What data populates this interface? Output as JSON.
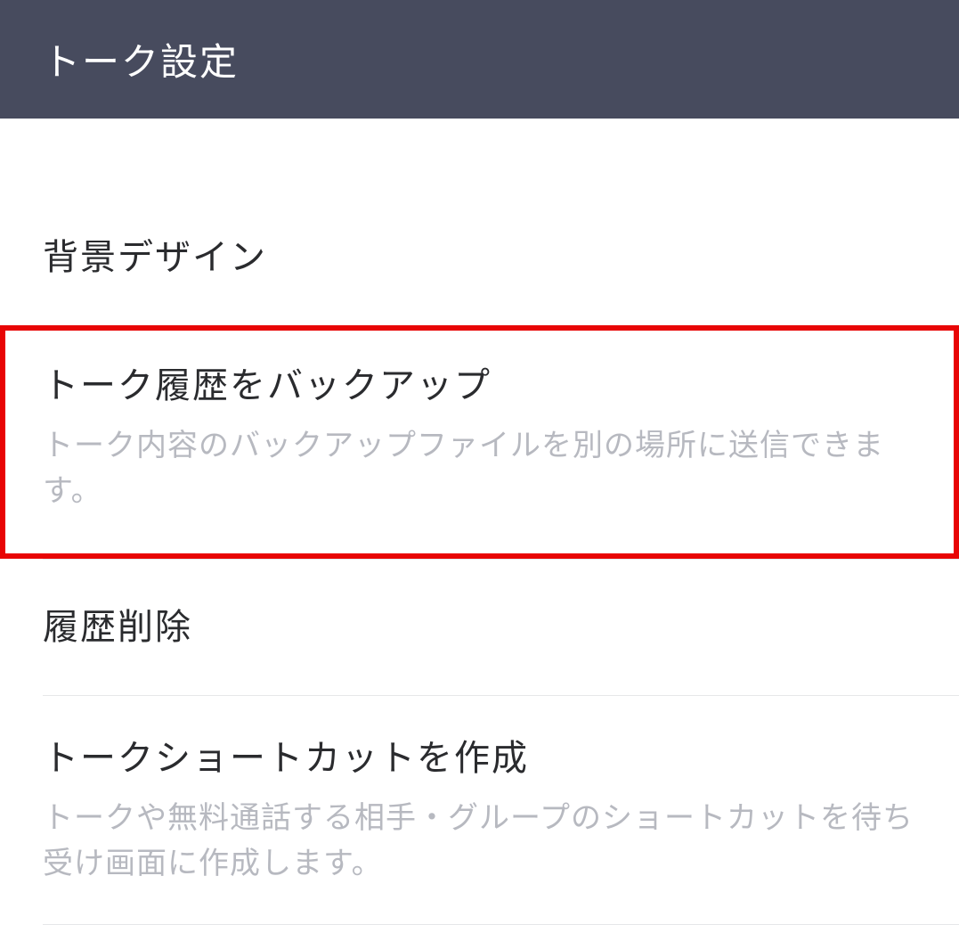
{
  "header": {
    "title": "トーク設定"
  },
  "items": [
    {
      "title": "背景デザイン",
      "description": null
    },
    {
      "title": "トーク履歴をバックアップ",
      "description": "トーク内容のバックアップファイルを別の場所に送信できます。",
      "highlighted": true
    },
    {
      "title": "履歴削除",
      "description": null
    },
    {
      "title": "トークショートカットを作成",
      "description": "トークや無料通話する相手・グループのショートカットを待ち受け画面に作成します。"
    }
  ]
}
